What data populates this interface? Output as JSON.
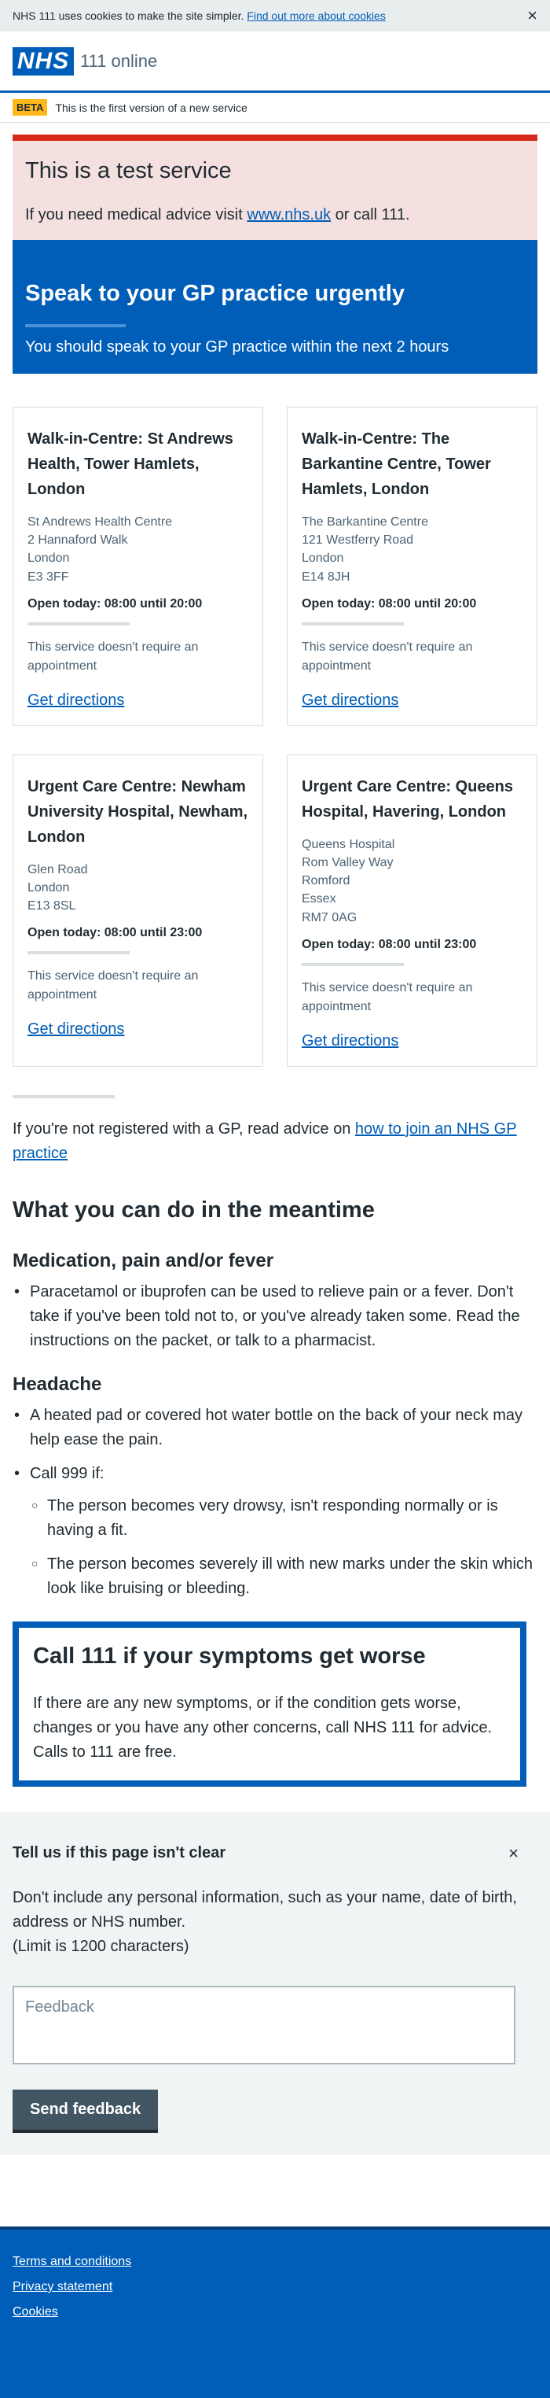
{
  "cookie_banner": {
    "text": "NHS 111 uses cookies to make the site simpler.",
    "link": "Find out more about cookies",
    "close": "×"
  },
  "header": {
    "logo": "NHS",
    "service_name": "111 online"
  },
  "beta": {
    "tag": "BETA",
    "text": "This is the first version of a new service"
  },
  "test_banner": {
    "title": "This is a test service",
    "text_before": "If you need medical advice visit ",
    "link": "www.nhs.uk",
    "text_after": " or call 111."
  },
  "care_banner": {
    "title": "Speak to your GP practice urgently",
    "subtitle": "You should speak to your GP practice within the next 2 hours"
  },
  "services": [
    {
      "name": "Walk-in-Centre: St Andrews Health, Tower Hamlets, London",
      "address": [
        "St Andrews Health Centre",
        "2 Hannaford Walk",
        "London",
        "E3 3FF"
      ],
      "hours": "Open today: 08:00 until 20:00",
      "appointment": "This service doesn't require an appointment",
      "directions": "Get directions"
    },
    {
      "name": "Walk-in-Centre: The Barkantine Centre, Tower Hamlets, London",
      "address": [
        "The Barkantine Centre",
        "121 Westferry Road",
        "London",
        "E14 8JH"
      ],
      "hours": "Open today: 08:00 until 20:00",
      "appointment": "This service doesn't require an appointment",
      "directions": "Get directions"
    },
    {
      "name": "Urgent Care Centre: Newham University Hospital, Newham, London",
      "address": [
        "Glen Road",
        "London",
        "E13 8SL"
      ],
      "hours": "Open today: 08:00 until 23:00",
      "appointment": "This service doesn't require an appointment",
      "directions": "Get directions"
    },
    {
      "name": "Urgent Care Centre: Queens Hospital, Havering, London",
      "address": [
        "Queens Hospital",
        "Rom Valley Way",
        "Romford",
        "Essex",
        "RM7 0AG"
      ],
      "hours": "Open today: 08:00 until 23:00",
      "appointment": "This service doesn't require an appointment",
      "directions": "Get directions"
    }
  ],
  "gp_advice": {
    "text": "If you're not registered with a GP, read advice on ",
    "link": "how to join an NHS GP practice"
  },
  "meantime": {
    "title": "What you can do in the meantime",
    "medication": {
      "title": "Medication, pain and/or fever",
      "item": "Paracetamol or ibuprofen can be used to relieve pain or a fever. Don't take if you've been told not to, or you've already taken some. Read the instructions on the packet, or talk to a pharmacist."
    },
    "headache": {
      "title": "Headache",
      "item1": "A heated pad or covered hot water bottle on the back of your neck may help ease the pain.",
      "item2": "Call 999 if:",
      "sub1": "The person becomes very drowsy, isn't responding normally or is having a fit.",
      "sub2": "The person becomes severely ill with new marks under the skin which look like bruising or bleeding."
    }
  },
  "worse": {
    "title": "Call 111 if your symptoms get worse",
    "text": "If there are any new symptoms, or if the condition gets worse, changes or you have any other concerns, call NHS 111 for advice. Calls to 111 are free."
  },
  "feedback": {
    "title": "Tell us if this page isn't clear",
    "close": "×",
    "info": "Don't include any personal information, such as your name, date of birth, address or NHS number.",
    "limit": "(Limit is 1200 characters)",
    "placeholder": "Feedback",
    "button": "Send feedback"
  },
  "footer": {
    "links": [
      "Terms and conditions",
      "Privacy statement",
      "Cookies"
    ]
  }
}
